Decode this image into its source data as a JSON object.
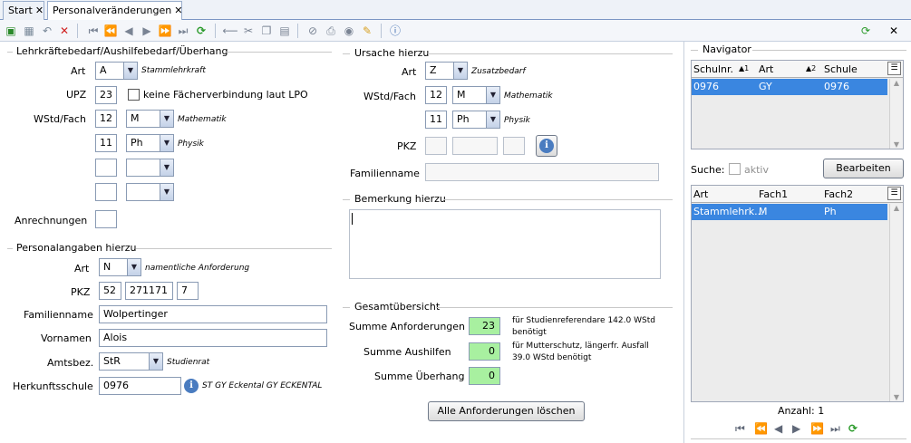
{
  "tabs": [
    {
      "label": "Start"
    },
    {
      "label": "Personalveränderungen"
    }
  ],
  "lehrkraft": {
    "title": "Lehrkräftebedarf/Aushilfebedarf/Überhang",
    "art_label": "Art",
    "art_value": "A",
    "art_hint": "Stammlehrkraft",
    "upz_label": "UPZ",
    "upz_value": "23",
    "checkbox_label": "keine Fächerverbindung laut LPO",
    "wstd_label": "WStd/Fach",
    "rows": [
      {
        "wstd": "12",
        "fach": "M",
        "hint": "Mathematik"
      },
      {
        "wstd": "11",
        "fach": "Ph",
        "hint": "Physik"
      }
    ],
    "anrechnungen_label": "Anrechnungen"
  },
  "personal": {
    "title": "Personalangaben hierzu",
    "art_label": "Art",
    "art_value": "N",
    "art_hint": "namentliche Anforderung",
    "pkz_label": "PKZ",
    "pkz1": "52",
    "pkz2": "271171",
    "pkz3": "7",
    "familienname_label": "Familienname",
    "familienname": "Wolpertinger",
    "vornamen_label": "Vornamen",
    "vornamen": "Alois",
    "amtsbez_label": "Amtsbez.",
    "amtsbez_value": "StR",
    "amtsbez_hint": "Studienrat",
    "herkunft_label": "Herkunftsschule",
    "herkunft_value": "0976",
    "herkunft_hint": "ST GY Eckental GY ECKENTAL"
  },
  "ursache": {
    "title": "Ursache hierzu",
    "art_label": "Art",
    "art_value": "Z",
    "art_hint": "Zusatzbedarf",
    "wstd_label": "WStd/Fach",
    "rows": [
      {
        "wstd": "12",
        "fach": "M",
        "hint": "Mathematik"
      },
      {
        "wstd": "11",
        "fach": "Ph",
        "hint": "Physik"
      }
    ],
    "pkz_label": "PKZ",
    "familienname_label": "Familienname"
  },
  "bemerkung": {
    "title": "Bemerkung hierzu"
  },
  "gesamt": {
    "title": "Gesamtübersicht",
    "anforderungen_label": "Summe Anforderungen",
    "anforderungen_value": "23",
    "anforderungen_note": "für Studienreferendare 142.0 WStd benötigt",
    "aushilfen_label": "Summe Aushilfen",
    "aushilfen_value": "0",
    "aushilfen_note": "für Mutterschutz, längerfr. Ausfall 39.0 WStd benötigt",
    "ueberhang_label": "Summe Überhang",
    "ueberhang_value": "0",
    "button": "Alle Anforderungen löschen"
  },
  "navigator": {
    "title": "Navigator",
    "grid1": {
      "headers": [
        "Schulnr.",
        "Art",
        "Schule"
      ],
      "sort": [
        "▲1",
        "▲2"
      ],
      "row": [
        "0976",
        "GY",
        "0976"
      ]
    },
    "suche_label": "Suche:",
    "aktiv_label": "aktiv",
    "bearbeiten": "Bearbeiten",
    "grid2": {
      "headers": [
        "Art",
        "Fach1",
        "Fach2"
      ],
      "row": [
        "Stammlehrk...",
        "M",
        "Ph"
      ]
    },
    "anzahl": "Anzahl: 1"
  },
  "colors": {
    "selection": "#3a86e0",
    "highlight": "#a8f0a0"
  }
}
